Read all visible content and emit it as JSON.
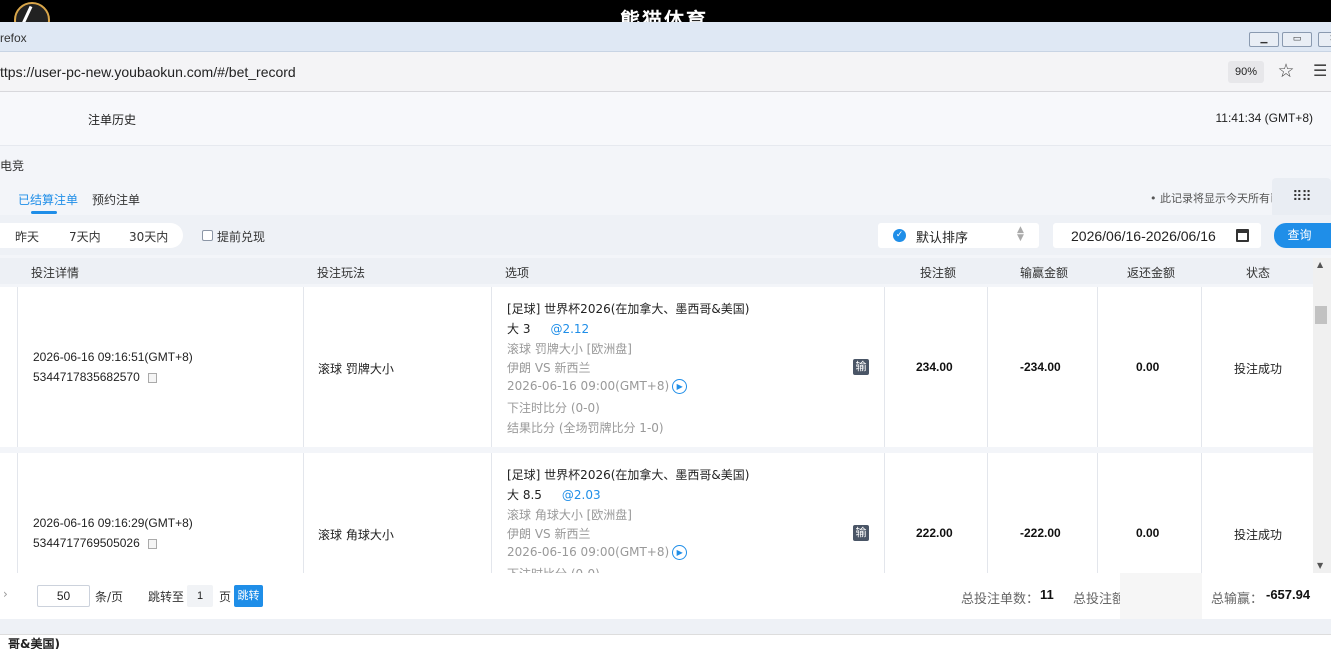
{
  "app": {
    "title": "熊猫体育"
  },
  "browser": {
    "window_title": "refox",
    "url": "ttps://user-pc-new.youbaokun.com/#/bet_record",
    "zoom": "90%",
    "min_label": "▭",
    "max_label": "▣"
  },
  "header": {
    "title": "注单历史",
    "clock": "11:41:34 (GMT+8)"
  },
  "category": "电竞",
  "tabs": [
    {
      "label": "已结算注单",
      "active": true
    },
    {
      "label": "预约注单",
      "active": false
    }
  ],
  "note": "• 此记录将显示今天所有已",
  "filters": {
    "ranges": [
      "昨天",
      "7天内",
      "30天内"
    ],
    "early_cashout": "提前兑现",
    "sort_label": "默认排序",
    "date_range": "2026/06/16-2026/06/16",
    "query": "查询"
  },
  "columns": [
    "投注详情",
    "投注玩法",
    "选项",
    "投注额",
    "输赢金额",
    "返还金额",
    "状态"
  ],
  "bets": [
    {
      "time": "2026-06-16 09:16:51(GMT+8)",
      "id": "5344717835682570",
      "play": "滚球   罚牌大小",
      "league": "[足球] 世界杯2026(在加拿大、墨西哥&美国)",
      "pick": "大 3",
      "odds": "@2.12",
      "market": "滚球 罚牌大小 [欧洲盘]",
      "match": "伊朗 VS 新西兰",
      "match_time": "2026-06-16 09:00(GMT+8)",
      "bet_score": "下注时比分 (0-0)",
      "result": "结果比分 (全场罚牌比分 1-0)",
      "badge": "输",
      "stake": "234.00",
      "win": "-234.00",
      "returned": "0.00",
      "status": "投注成功"
    },
    {
      "time": "2026-06-16 09:16:29(GMT+8)",
      "id": "5344717769505026",
      "play": "滚球   角球大小",
      "league": "[足球] 世界杯2026(在加拿大、墨西哥&美国)",
      "pick": "大 8.5",
      "odds": "@2.03",
      "market": "滚球 角球大小 [欧洲盘]",
      "match": "伊朗 VS 新西兰",
      "match_time": "2026-06-16 09:00(GMT+8)",
      "bet_score": "下注时比分 (0-0)",
      "badge": "输",
      "stake": "222.00",
      "win": "-222.00",
      "returned": "0.00",
      "status": "投注成功"
    }
  ],
  "footer": {
    "per_page": "50",
    "per_page_unit": "条/页",
    "jump_label": "跳转至",
    "jump_page": "1",
    "page_unit": "页",
    "jump_btn": "跳转",
    "total_count_label": "总投注单数：",
    "total_count": "11",
    "total_stake_label": "总投注额",
    "total_win_label": "总输赢：",
    "total_win": "-657.94"
  },
  "bottom_text": "哥&美国)"
}
